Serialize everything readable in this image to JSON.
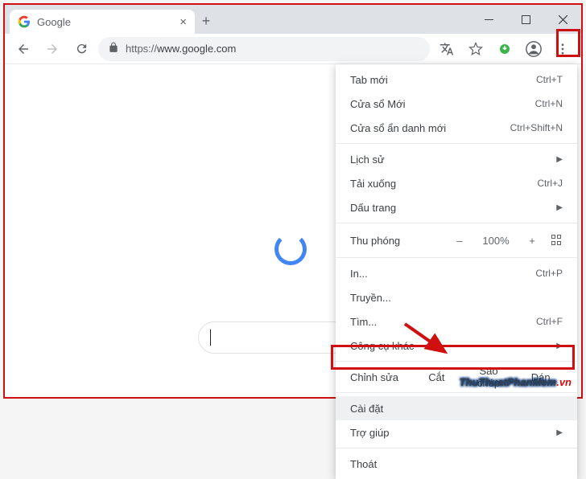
{
  "tab": {
    "title": "Google"
  },
  "url": {
    "scheme": "https://",
    "host": "www.google.com"
  },
  "menu": {
    "new_tab": {
      "label": "Tab mới",
      "shortcut": "Ctrl+T"
    },
    "new_window": {
      "label": "Cửa sổ Mới",
      "shortcut": "Ctrl+N"
    },
    "incognito": {
      "label": "Cửa sổ ẩn danh mới",
      "shortcut": "Ctrl+Shift+N"
    },
    "history": {
      "label": "Lịch sử"
    },
    "downloads": {
      "label": "Tải xuống",
      "shortcut": "Ctrl+J"
    },
    "bookmarks": {
      "label": "Dấu trang"
    },
    "zoom": {
      "label": "Thu phóng",
      "minus": "–",
      "value": "100%",
      "plus": "+"
    },
    "print": {
      "label": "In...",
      "shortcut": "Ctrl+P"
    },
    "cast": {
      "label": "Truyền..."
    },
    "find": {
      "label": "Tìm...",
      "shortcut": "Ctrl+F"
    },
    "more_tools": {
      "label": "Công cụ khác"
    },
    "edit": {
      "label": "Chỉnh sửa",
      "cut": "Cắt",
      "copy": "Sao chép",
      "paste": "Dán"
    },
    "settings": {
      "label": "Cài đặt"
    },
    "help": {
      "label": "Trợ giúp"
    },
    "exit": {
      "label": "Thoát"
    }
  },
  "watermark": {
    "a": "ThuThuatPhanMem",
    "b": ".vn"
  }
}
